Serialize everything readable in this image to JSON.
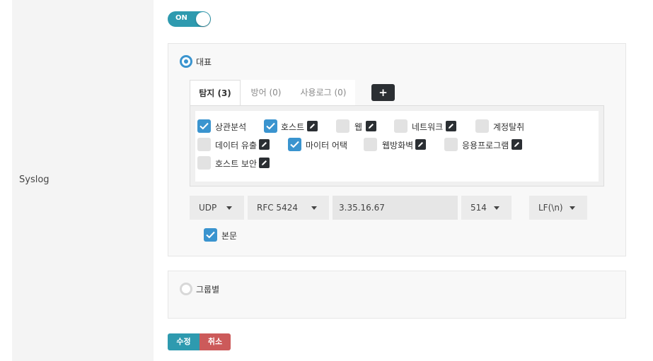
{
  "field_label": "Syslog",
  "toggle": {
    "label": "ON",
    "state": "on"
  },
  "mode": {
    "representative_label": "대표",
    "group_label": "그룹별",
    "selected": "representative"
  },
  "tabs": [
    {
      "label": "탐지 (3)",
      "active": true
    },
    {
      "label": "방어 (0)",
      "active": false
    },
    {
      "label": "사용로그 (0)",
      "active": false
    }
  ],
  "add_button": "+",
  "categories": [
    {
      "label": "상관분석",
      "checked": true,
      "editable": false
    },
    {
      "label": "호스트",
      "checked": true,
      "editable": true
    },
    {
      "label": "웹",
      "checked": false,
      "editable": true
    },
    {
      "label": "네트워크",
      "checked": false,
      "editable": true
    },
    {
      "label": "계정탈취",
      "checked": false,
      "editable": false
    },
    {
      "label": "데이터 유출",
      "checked": false,
      "editable": true
    },
    {
      "label": "마이터 어택",
      "checked": true,
      "editable": false
    },
    {
      "label": "웹방화벽",
      "checked": false,
      "editable": true
    },
    {
      "label": "응용프로그램",
      "checked": false,
      "editable": true
    },
    {
      "label": "호스트 보안",
      "checked": false,
      "editable": true
    }
  ],
  "transport": {
    "protocol": "UDP",
    "format": "RFC 5424",
    "host": "3.35.16.67",
    "port": "514",
    "line_ending": "LF(\\n)"
  },
  "body": {
    "label": "본문",
    "checked": true
  },
  "buttons": {
    "save": "수정",
    "cancel": "취소"
  },
  "colors": {
    "accent": "#2e9aaf",
    "checkbox": "#3a94cf",
    "cancel": "#cc5a5a",
    "dark": "#2b2f33"
  }
}
